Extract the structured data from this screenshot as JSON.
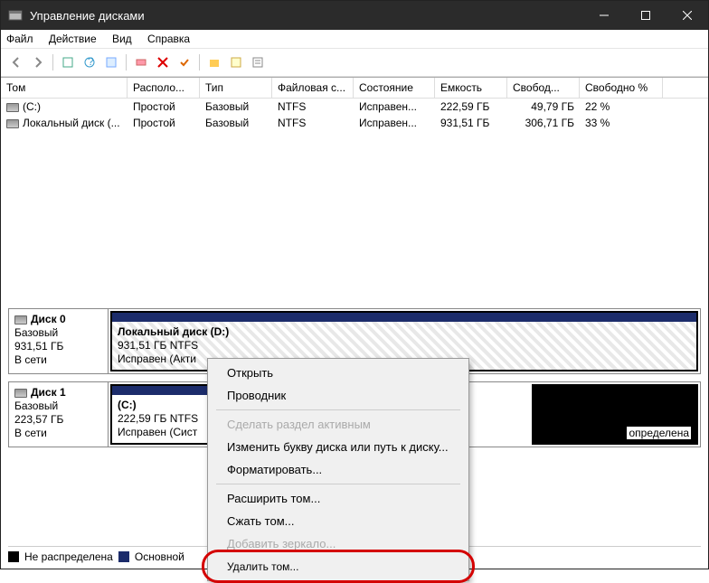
{
  "window": {
    "title": "Управление дисками"
  },
  "menu": {
    "file": "Файл",
    "action": "Действие",
    "view": "Вид",
    "help": "Справка"
  },
  "table": {
    "headers": [
      "Том",
      "Располо...",
      "Тип",
      "Файловая с...",
      "Состояние",
      "Емкость",
      "Свобод...",
      "Свободно %"
    ],
    "rows": [
      {
        "vol": "(C:)",
        "layout": "Простой",
        "type": "Базовый",
        "fs": "NTFS",
        "status": "Исправен...",
        "cap": "222,59 ГБ",
        "free": "49,79 ГБ",
        "pct": "22 %"
      },
      {
        "vol": "Локальный диск (...",
        "layout": "Простой",
        "type": "Базовый",
        "fs": "NTFS",
        "status": "Исправен...",
        "cap": "931,51 ГБ",
        "free": "306,71 ГБ",
        "pct": "33 %"
      }
    ]
  },
  "disks": [
    {
      "name": "Диск 0",
      "type": "Базовый",
      "size": "931,51 ГБ",
      "status": "В сети",
      "vols": [
        {
          "title": "Локальный диск  (D:)",
          "l2": "931,51 ГБ NTFS",
          "l3": "Исправен (Акти"
        }
      ]
    },
    {
      "name": "Диск 1",
      "type": "Базовый",
      "size": "223,57 ГБ",
      "status": "В сети",
      "vols": [
        {
          "title": "(C:)",
          "l2": "222,59 ГБ NTFS",
          "l3": "Исправен (Сист"
        }
      ],
      "extraText": "определена"
    }
  ],
  "legend": {
    "unalloc": "Не распределена",
    "primary": "Основной"
  },
  "context": {
    "items": [
      {
        "label": "Открыть",
        "en": true
      },
      {
        "label": "Проводник",
        "en": true
      },
      {
        "sep": true
      },
      {
        "label": "Сделать раздел активным",
        "en": false
      },
      {
        "label": "Изменить букву диска или путь к диску...",
        "en": true
      },
      {
        "label": "Форматировать...",
        "en": true
      },
      {
        "sep": true
      },
      {
        "label": "Расширить том...",
        "en": true
      },
      {
        "label": "Сжать том...",
        "en": true
      },
      {
        "label": "Добавить зеркало...",
        "en": false
      },
      {
        "label": "Удалить том...",
        "en": true,
        "hl": true
      }
    ]
  }
}
